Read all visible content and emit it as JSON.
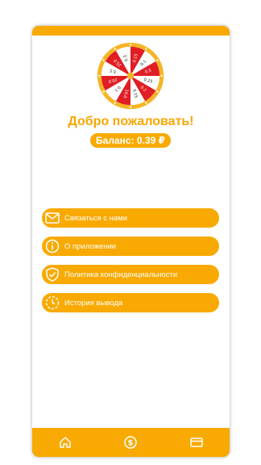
{
  "wheel": {
    "segments": [
      "0.15",
      "0.1",
      "0.5",
      "0.25",
      "0.2",
      "0.15",
      "10.0",
      "0.1",
      "20.0",
      "0.5",
      "25.0",
      "0.3"
    ]
  },
  "welcome": "Добро пожаловать!",
  "balance": "Баланс: 0.39 ₽",
  "menu": [
    {
      "label": "Связаться с нами",
      "icon": "mail-icon"
    },
    {
      "label": "О приложении",
      "icon": "info-icon"
    },
    {
      "label": "Политика конфиденциальности",
      "icon": "shield-check-icon"
    },
    {
      "label": "История вывода",
      "icon": "clock-history-icon"
    }
  ],
  "nav": [
    "home-icon",
    "dollar-icon",
    "card-icon"
  ],
  "colors": {
    "accent": "#f8aa02",
    "wheel_red": "#e01e24",
    "wheel_gold": "#f6b426"
  }
}
